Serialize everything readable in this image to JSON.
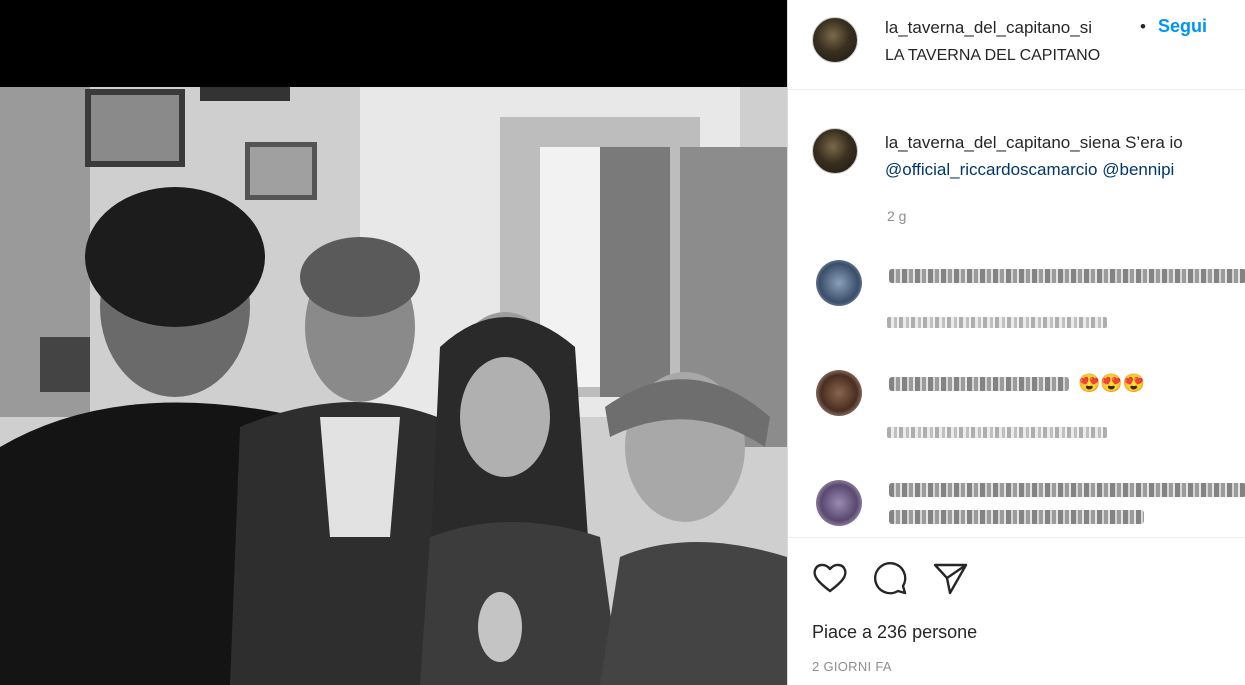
{
  "header": {
    "username": "la_taverna_del_capitano_si",
    "separator": "•",
    "follow_label": "Segui",
    "location": "LA TAVERNA DEL CAPITANO"
  },
  "caption": {
    "username": "la_taverna_del_capitano_siena",
    "text": "S’era io",
    "mentions": "@official_riccardoscamarcio @bennipi",
    "time": "2 g"
  },
  "comments": [
    {
      "blurred": true
    },
    {
      "blurred": true,
      "emoji": "😍😍😍"
    },
    {
      "blurred": true
    }
  ],
  "actions": {
    "like": "heart-icon",
    "comment": "comment-icon",
    "share": "share-icon"
  },
  "likes_text": "Piace a 236 persone",
  "posted_ago": "2 GIORNI FA"
}
